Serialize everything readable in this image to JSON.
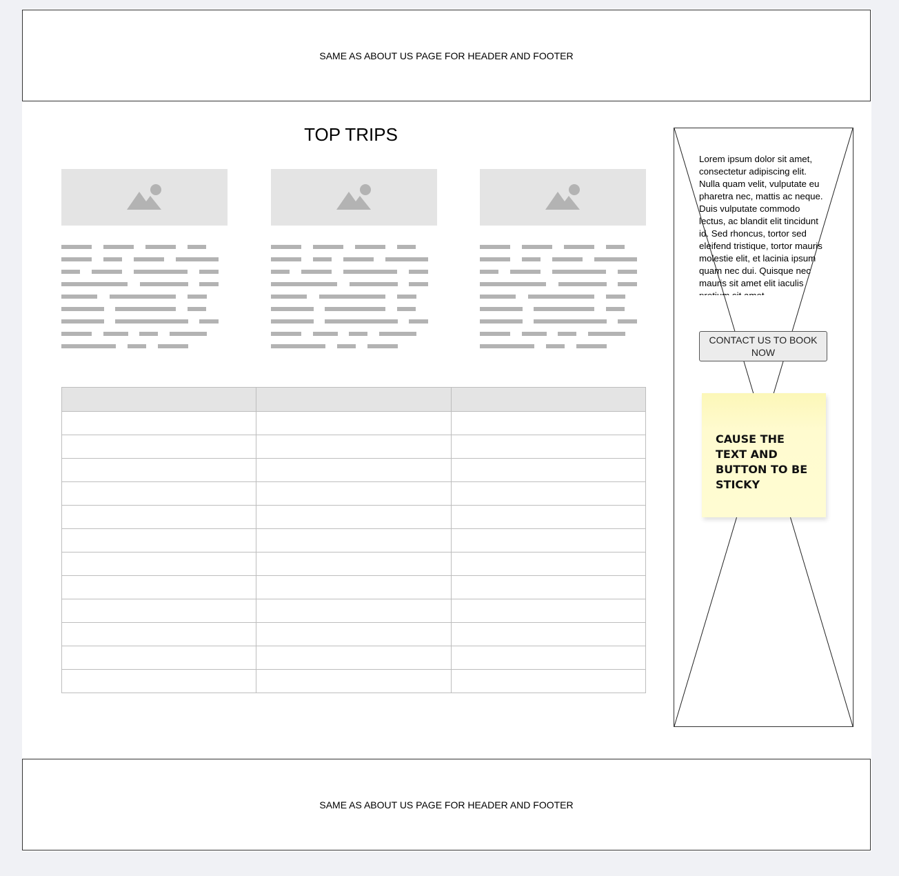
{
  "header": {
    "text": "SAME AS ABOUT US PAGE FOR HEADER AND FOOTER"
  },
  "footer": {
    "text": "SAME AS ABOUT US PAGE FOR HEADER AND FOOTER"
  },
  "main": {
    "title": "TOP TRIPS",
    "cards": [
      {
        "image_icon": "image-placeholder-icon"
      },
      {
        "image_icon": "image-placeholder-icon"
      },
      {
        "image_icon": "image-placeholder-icon"
      }
    ],
    "table": {
      "rows": 12,
      "columns": 3
    }
  },
  "sidebar": {
    "lorem": "Lorem ipsum dolor sit amet, consectetur adipiscing elit. Nulla quam velit, vulputate eu pharetra nec, mattis ac neque. Duis vulputate commodo lectus, ac blandit elit tincidunt id. Sed rhoncus, tortor sed eleifend tristique, tortor mauris molestie elit, et lacinia ipsum quam nec dui. Quisque nec mauris sit amet elit iaculis pretium sit amet",
    "cta_label": "CONTACT US TO BOOK NOW",
    "sticky_note": "CAUSE THE TEXT AND BUTTON TO BE STICKY"
  },
  "colors": {
    "placeholder": "#e4e4e4",
    "text_lines": "#b3b3b3",
    "sticky": "#fffbcf"
  }
}
